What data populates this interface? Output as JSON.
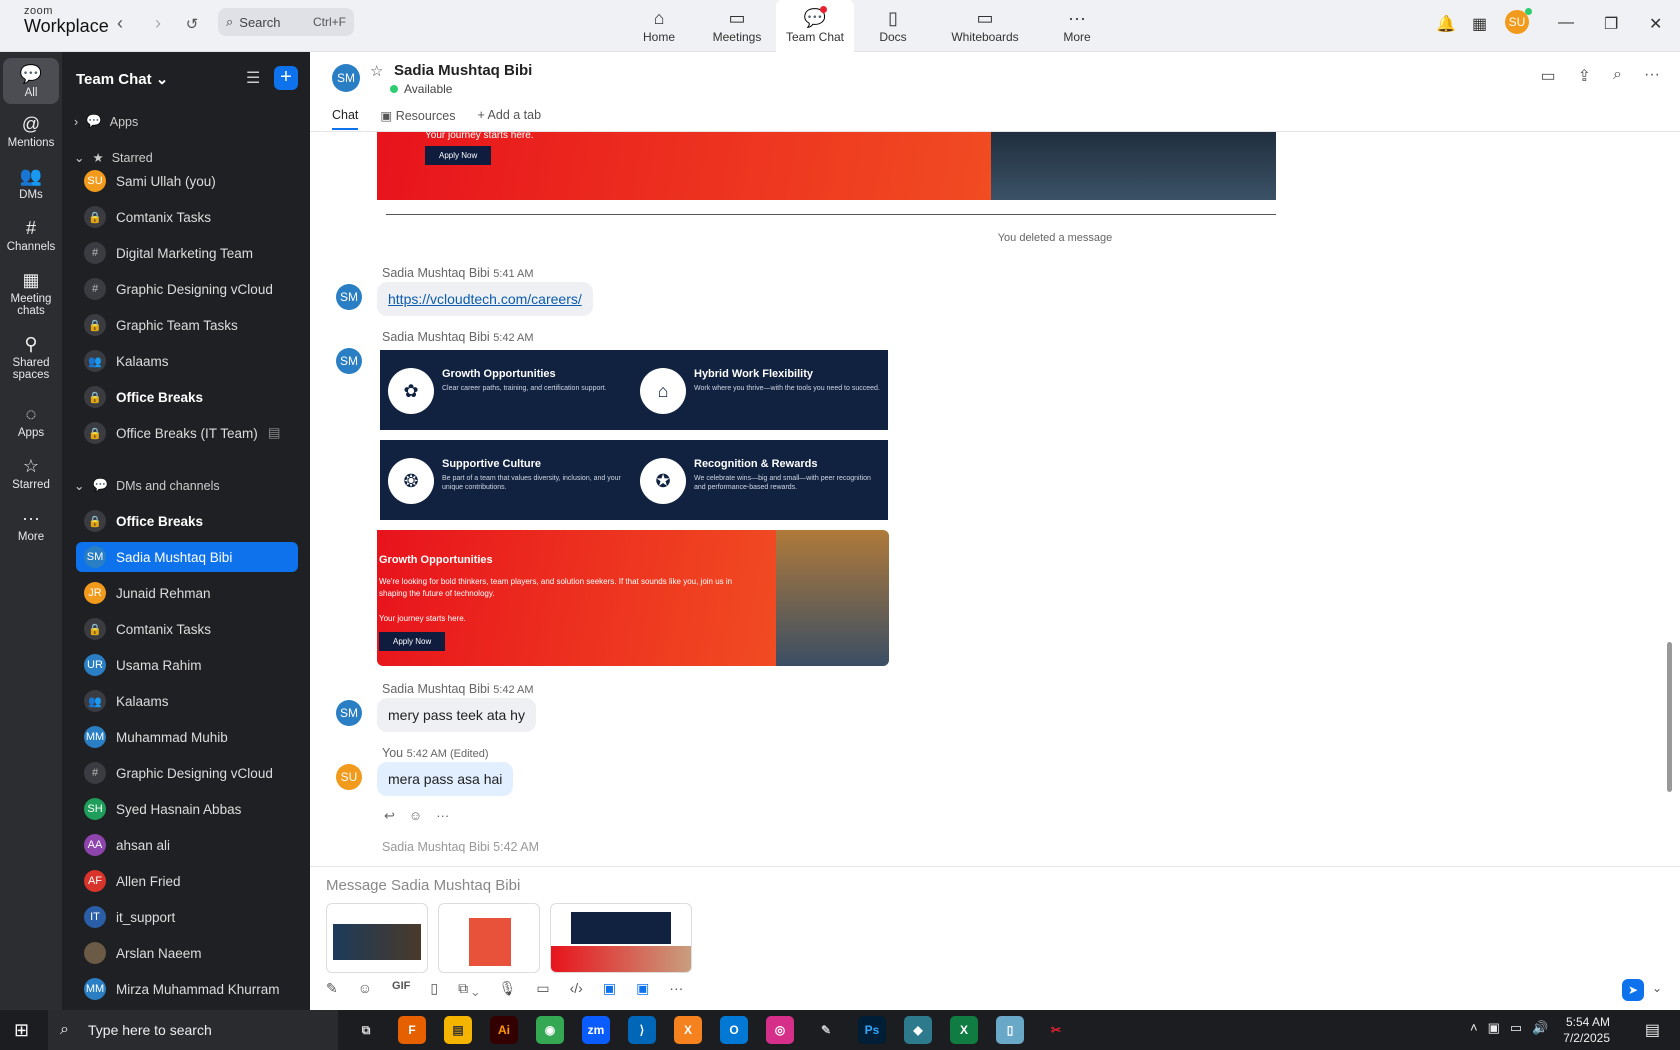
{
  "app": {
    "logo_small": "zoom",
    "logo_big": "Workplace",
    "search_placeholder": "Search",
    "search_shortcut": "Ctrl+F"
  },
  "topnav": [
    {
      "label": "Home",
      "icon": "home-icon"
    },
    {
      "label": "Meetings",
      "icon": "video-icon"
    },
    {
      "label": "Team Chat",
      "icon": "chat-icon"
    },
    {
      "label": "Docs",
      "icon": "doc-icon"
    },
    {
      "label": "Whiteboards",
      "icon": "whiteboard-icon"
    },
    {
      "label": "More",
      "icon": "more-icon"
    }
  ],
  "user_initials": "SU",
  "rail": [
    {
      "label": "All"
    },
    {
      "label": "Mentions"
    },
    {
      "label": "DMs"
    },
    {
      "label": "Channels"
    },
    {
      "label": "Meeting chats"
    },
    {
      "label": "Shared spaces"
    },
    {
      "label": "Apps"
    },
    {
      "label": "Starred"
    },
    {
      "label": "More"
    }
  ],
  "sidebar": {
    "title": "Team Chat",
    "sec_apps": "Apps",
    "sec_starred": "Starred",
    "sec_dms": "DMs and channels",
    "starred": [
      "Sami Ullah (you)",
      "Comtanix Tasks",
      "Digital Marketing Team",
      "Graphic Designing vCloud",
      "Graphic Team Tasks",
      "Kalaams",
      "Office Breaks",
      "Office Breaks (IT Team)"
    ],
    "dms": [
      "Office Breaks",
      "Sadia Mushtaq Bibi",
      "Junaid Rehman",
      "Comtanix Tasks",
      "Usama Rahim",
      "Kalaams",
      "Muhammad Muhib",
      "Graphic Designing vCloud",
      "Syed Hasnain Abbas",
      "ahsan ali",
      "Allen Fried",
      "it_support",
      "Arslan Naeem",
      "Mirza Muhammad Khurram"
    ],
    "initials": {
      "su": "SU",
      "sm": "SM",
      "jr": "JR",
      "ur": "UR",
      "mm": "MM",
      "sh": "SH",
      "aa": "AA",
      "af": "AF",
      "it": "IT"
    }
  },
  "chat": {
    "title": "Sadia Mushtaq Bibi",
    "status": "Available",
    "initials": "SM",
    "tabs": [
      "Chat",
      "Resources",
      "Add a tab"
    ],
    "deleted_note": "You deleted a message",
    "top_banner_text": "Your journey starts here.",
    "apply_now": "Apply Now",
    "msg1_sender": "Sadia Mushtaq Bibi",
    "msg1_time": "5:41 AM",
    "msg1_link": "https://vcloudtech.com/careers/",
    "msg2_sender": "Sadia Mushtaq Bibi",
    "msg2_time": "5:42 AM",
    "cards": [
      {
        "title": "Growth Opportunities",
        "desc": "Clear career paths, training, and certification support."
      },
      {
        "title": "Hybrid Work Flexibility",
        "desc": "Work where you thrive—with the tools you need to succeed."
      },
      {
        "title": "Supportive Culture",
        "desc": "Be part of a team that values diversity, inclusion, and your unique contributions."
      },
      {
        "title": "Recognition & Rewards",
        "desc": "We celebrate wins—big and small—with peer recognition and performance-based rewards."
      }
    ],
    "red_title": "Growth Opportunities",
    "red_desc": "We're looking for bold thinkers, team players, and solution seekers. If that sounds like you, join us in shaping the future of technology.",
    "red_sub": "Your journey starts here.",
    "msg3_sender": "Sadia Mushtaq Bibi",
    "msg3_time": "5:42 AM",
    "msg3_text": "mery pass teek ata hy",
    "msg4_sender": "You",
    "msg4_time": "5:42 AM (Edited)",
    "msg4_text": "mera pass asa hai",
    "msg5_partial": "Sadia Mushtaq Bibi 5:42 AM",
    "composer_placeholder": "Message Sadia Mushtaq Bibi",
    "gif": "GIF"
  },
  "taskbar": {
    "search": "Type here to search",
    "time": "5:54 AM",
    "date": "7/2/2025"
  }
}
